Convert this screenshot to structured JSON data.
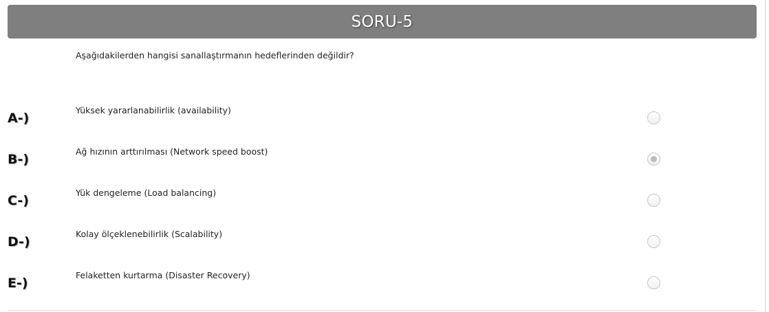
{
  "header": {
    "title": "SORU-5"
  },
  "question": {
    "text": "Aşağıdakilerden hangisi sanallaştırmanın hedeflerinden değildir?"
  },
  "options": [
    {
      "letter": "A-)",
      "text": "Yüksek yararlanabilirlik (availability)",
      "selected": false
    },
    {
      "letter": "B-)",
      "text": "Ağ hızının arttırılması (Network speed boost)",
      "selected": true
    },
    {
      "letter": "C-)",
      "text": "Yük dengeleme (Load balancing)",
      "selected": false
    },
    {
      "letter": "D-)",
      "text": "Kolay ölçeklenebilirlik (Scalability)",
      "selected": false
    },
    {
      "letter": "E-)",
      "text": "Felaketten kurtarma (Disaster Recovery)",
      "selected": false
    }
  ],
  "colors": {
    "header_bg": "#7f7f7f",
    "header_text": "#ffffff",
    "radio_selected": "#bdbdbd"
  }
}
